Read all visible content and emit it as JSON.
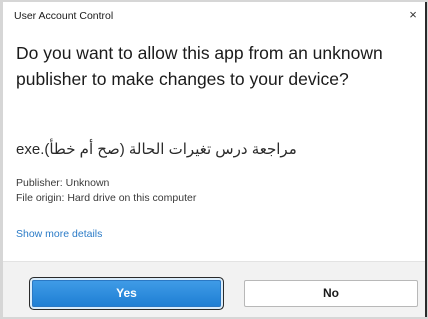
{
  "dialog": {
    "title": "User Account Control",
    "close_glyph": "×",
    "question": "Do you want to allow this app from an unknown publisher to make changes to your device?",
    "filename": "مراجعة درس تغيرات الحالة (صح أم خطأ).exe",
    "publisher": "Publisher: Unknown",
    "file_origin": "File origin: Hard drive on this computer",
    "more_details": "Show more details"
  },
  "buttons": {
    "yes": "Yes",
    "no": "No"
  },
  "colors": {
    "accent": "#1f7fd4",
    "link": "#2b7bc7",
    "footer": "#f2f2f2"
  }
}
